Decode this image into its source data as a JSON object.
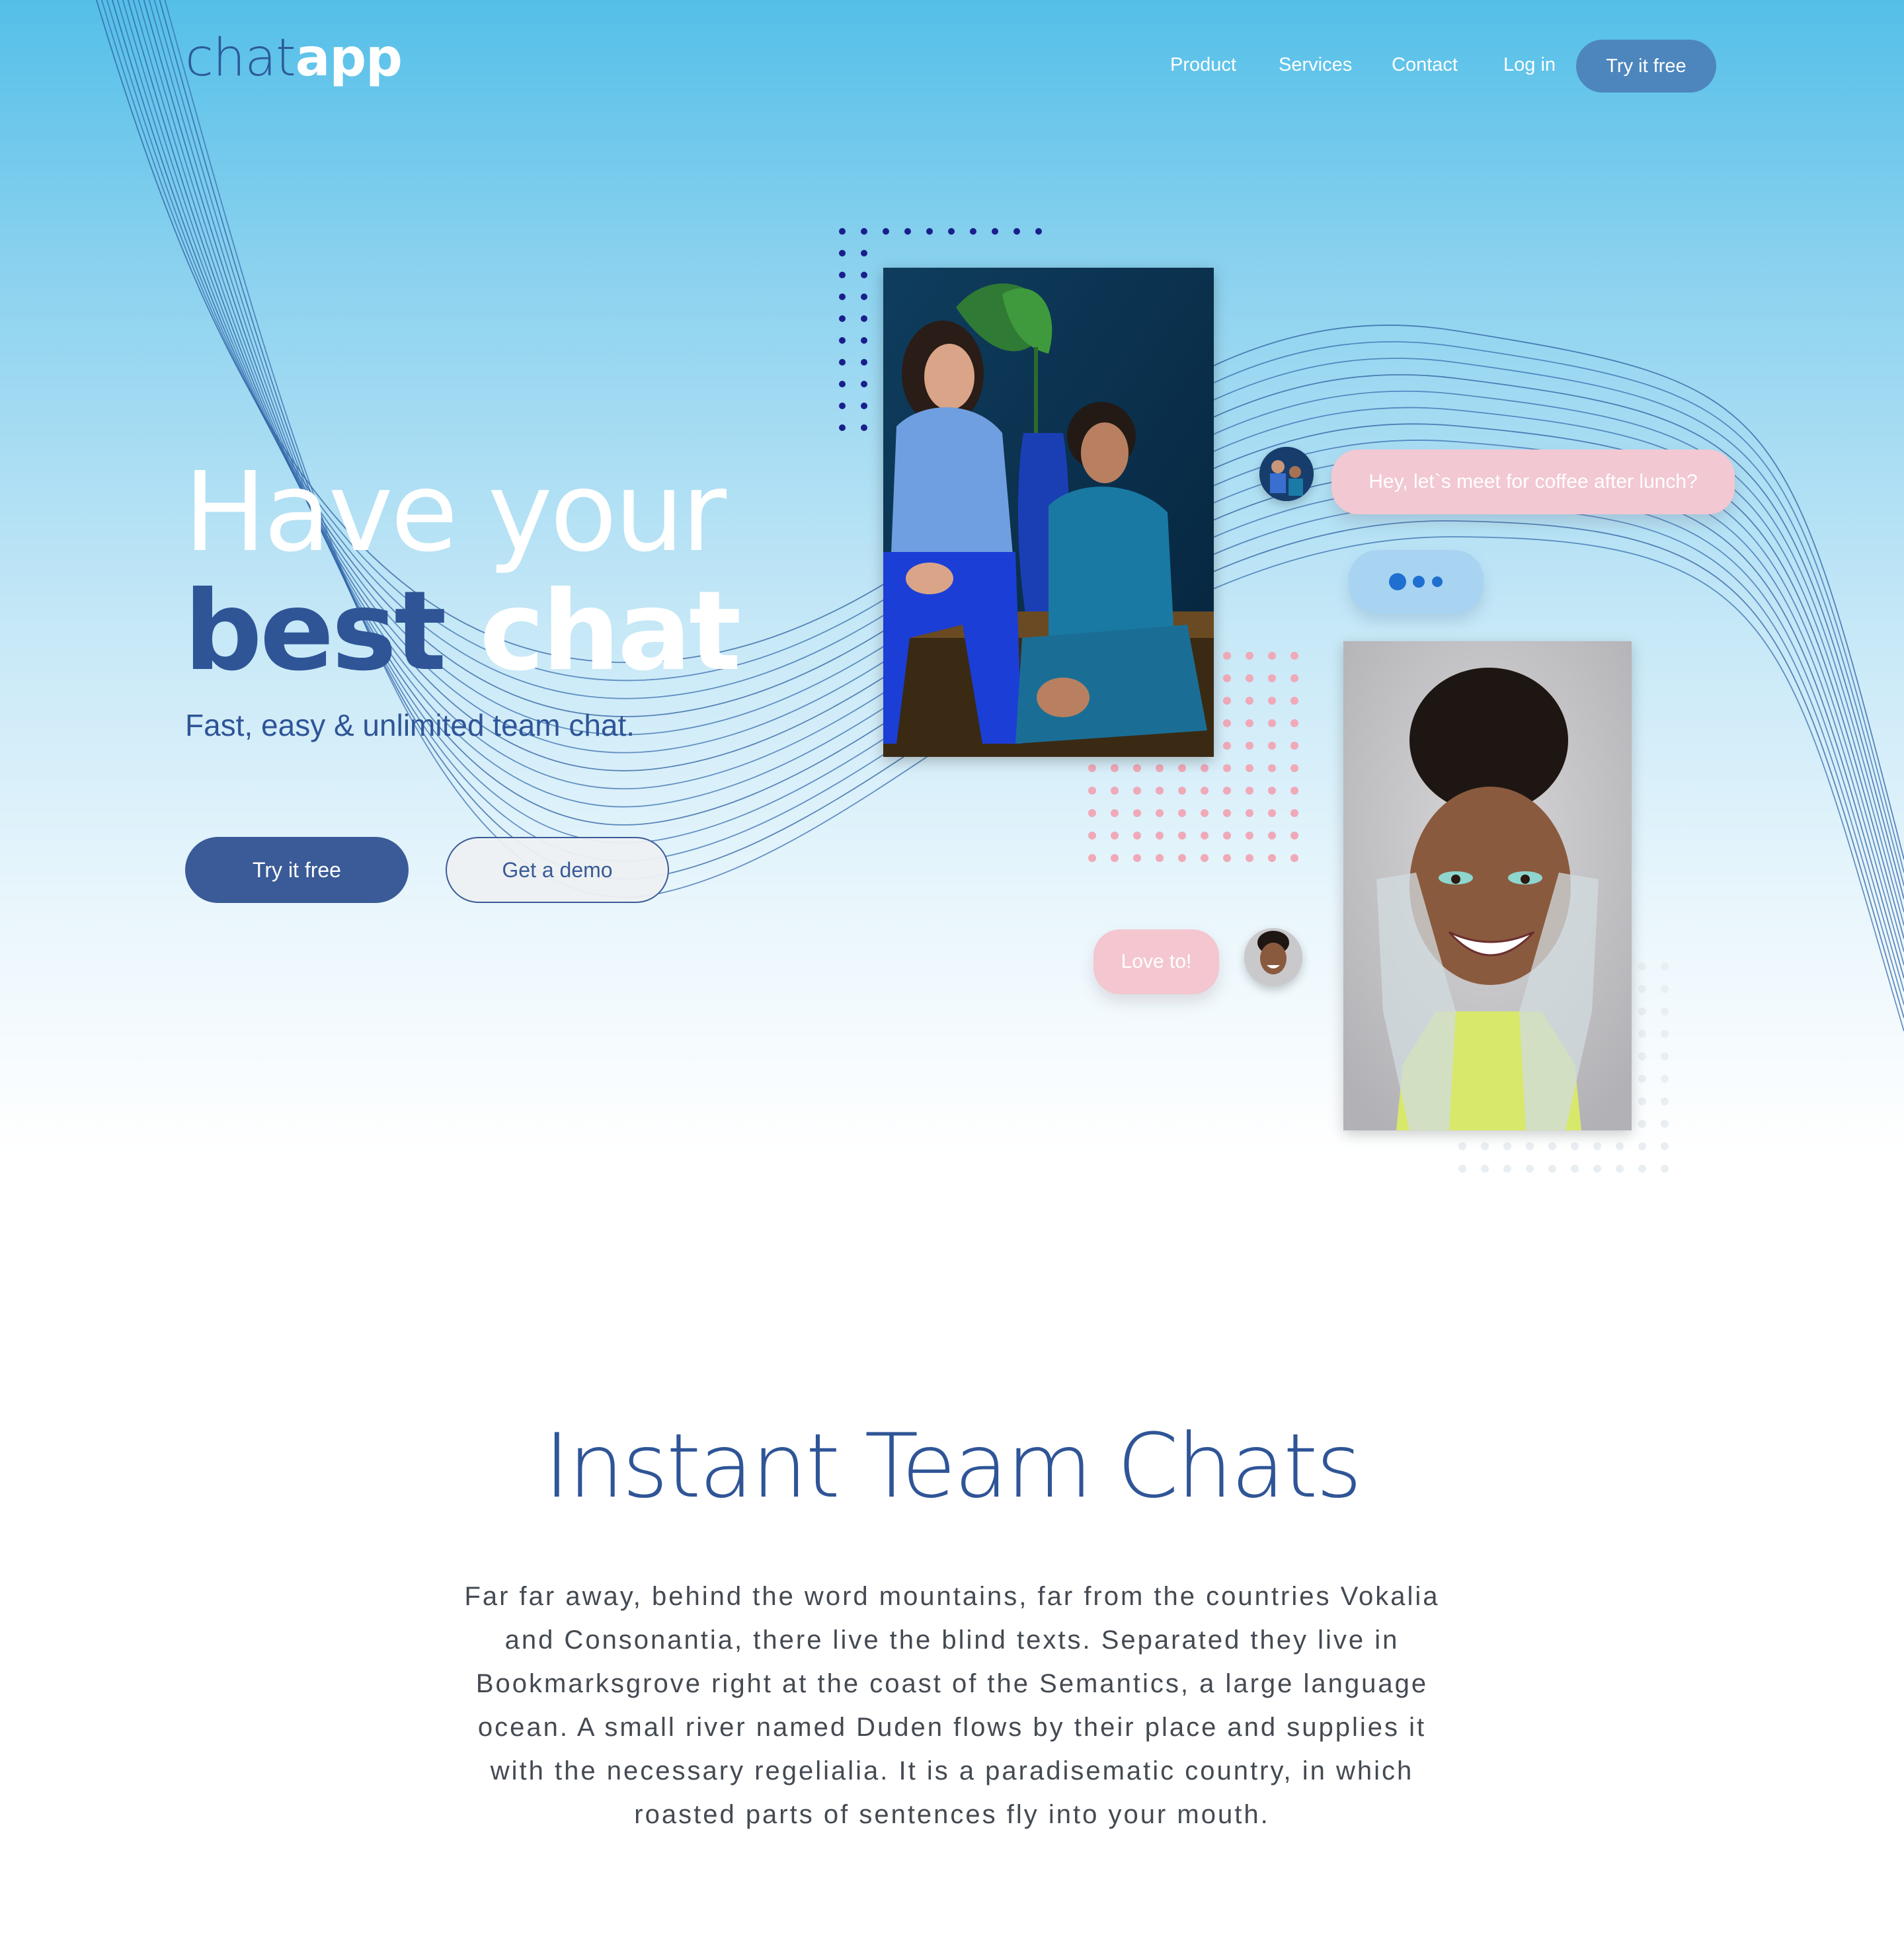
{
  "brand": {
    "part1": "chat",
    "part2": "app"
  },
  "nav": {
    "items": [
      {
        "label": "Product"
      },
      {
        "label": "Services"
      },
      {
        "label": "Contact"
      },
      {
        "label": "Log in"
      }
    ],
    "cta": "Try it free"
  },
  "hero": {
    "title_line1": "Have your",
    "title_line2a": "best",
    "title_line2b": "chat",
    "subtitle": "Fast, easy & unlimited team chat.",
    "primary_button": "Try it free",
    "secondary_button": "Get a demo"
  },
  "chat": {
    "message1": "Hey, let`s meet for coffee after lunch?",
    "message2": "Love to!"
  },
  "section": {
    "title": "Instant Team Chats",
    "body": "Far far away, behind the word mountains, far from the countries Vokalia and Consonantia, there live the blind texts. Separated they live in Bookmarksgrove right at the coast of the Semantics, a large language ocean. A small river named Duden flows by their place and supplies it with the necessary regelialia. It is a paradisematic country, in which roasted parts of sentences fly into your mouth."
  },
  "colors": {
    "brand_blue": "#2f5597",
    "sky": "#54bfe8",
    "bubble_pink": "#f2c8d2",
    "typing_blue": "#a8d4f2"
  }
}
